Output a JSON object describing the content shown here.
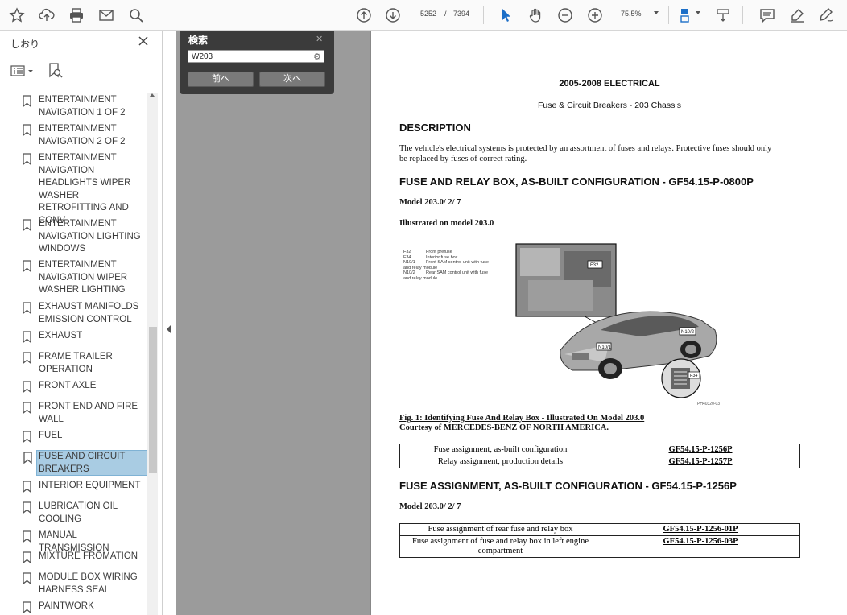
{
  "toolbar": {
    "current_page": "5252",
    "page_separator": "/",
    "total_pages": "7394",
    "zoom": "75.5%"
  },
  "sidebar": {
    "title": "しおり",
    "items": [
      {
        "label": "ENTERTAINMENT NAVIGATION 1 OF 2"
      },
      {
        "label": "ENTERTAINMENT NAVIGATION 2 OF 2"
      },
      {
        "label": "ENTERTAINMENT NAVIGATION HEADLIGHTS WIPER WASHER RETROFITTING AND CONV"
      },
      {
        "label": "ENTERTAINMENT NAVIGATION LIGHTING WINDOWS"
      },
      {
        "label": "ENTERTAINMENT NAVIGATION WIPER WASHER LIGHTING"
      },
      {
        "label": "EXHAUST MANIFOLDS EMISSION CONTROL"
      },
      {
        "label": "EXHAUST"
      },
      {
        "label": "FRAME TRAILER OPERATION"
      },
      {
        "label": "FRONT AXLE"
      },
      {
        "label": "FRONT END AND FIRE WALL"
      },
      {
        "label": "FUEL"
      },
      {
        "label": "FUSE AND CIRCUIT BREAKERS"
      },
      {
        "label": "INTERIOR EQUIPMENT"
      },
      {
        "label": "LUBRICATION OIL COOLING"
      },
      {
        "label": "MANUAL TRANSMISSION"
      },
      {
        "label": "MIXTURE FROMATION"
      },
      {
        "label": "MODULE BOX WIRING HARNESS SEAL"
      },
      {
        "label": "PAINTWORK"
      }
    ]
  },
  "search": {
    "title": "検索",
    "close": "✕",
    "query": "W203",
    "prev_label": "前へ",
    "next_label": "次へ"
  },
  "document": {
    "heading": "2005-2008 ELECTRICAL",
    "subheading": "Fuse & Circuit Breakers - 203 Chassis",
    "description_title": "DESCRIPTION",
    "description_text_1": "The vehicle's electrical systems is protected by an assortment of fuses and relays. Protective fuses should only",
    "description_text_2": "be replaced by fuses of correct rating.",
    "section1_title": "FUSE AND RELAY BOX, AS-BUILT CONFIGURATION - GF54.15-P-0800P",
    "section1_model": "Model 203.0/ 2/ 7",
    "section1_illustrated": "Illustrated on model 203.0",
    "figure_legend": [
      {
        "code": "F32",
        "text": "Front prefuse"
      },
      {
        "code": "F34",
        "text": "Interior fuse box"
      },
      {
        "code": "N10/1",
        "text": "Front SAM control unit with fuse and relay module"
      },
      {
        "code": "N10/2",
        "text": "Rear SAM control unit with fuse and relay module"
      }
    ],
    "figure_labels": {
      "f32": "F32",
      "n10_1": "N10/1",
      "n10_2": "N10/2",
      "f34": "F34",
      "figure_id": "PH40320-03"
    },
    "figure_caption": "Fig. 1: Identifying Fuse And Relay Box - Illustrated On Model 203.0",
    "courtesy": "Courtesy of MERCEDES-BENZ OF NORTH AMERICA.",
    "table1": [
      {
        "desc": "Fuse assignment, as-built configuration",
        "ref": "GF54.15-P-1256P"
      },
      {
        "desc": "Relay assignment, production details",
        "ref": "GF54.15-P-1257P"
      }
    ],
    "section2_title": "FUSE ASSIGNMENT, AS-BUILT CONFIGURATION - GF54.15-P-1256P",
    "section2_model": "Model 203.0/ 2/ 7",
    "table2": [
      {
        "desc": "Fuse assignment of rear fuse and relay box",
        "ref": "GF54.15-P-1256-01P"
      },
      {
        "desc": "Fuse assignment of fuse and relay box in left engine compartment",
        "ref": "GF54.15-P-1256-03P"
      }
    ]
  }
}
